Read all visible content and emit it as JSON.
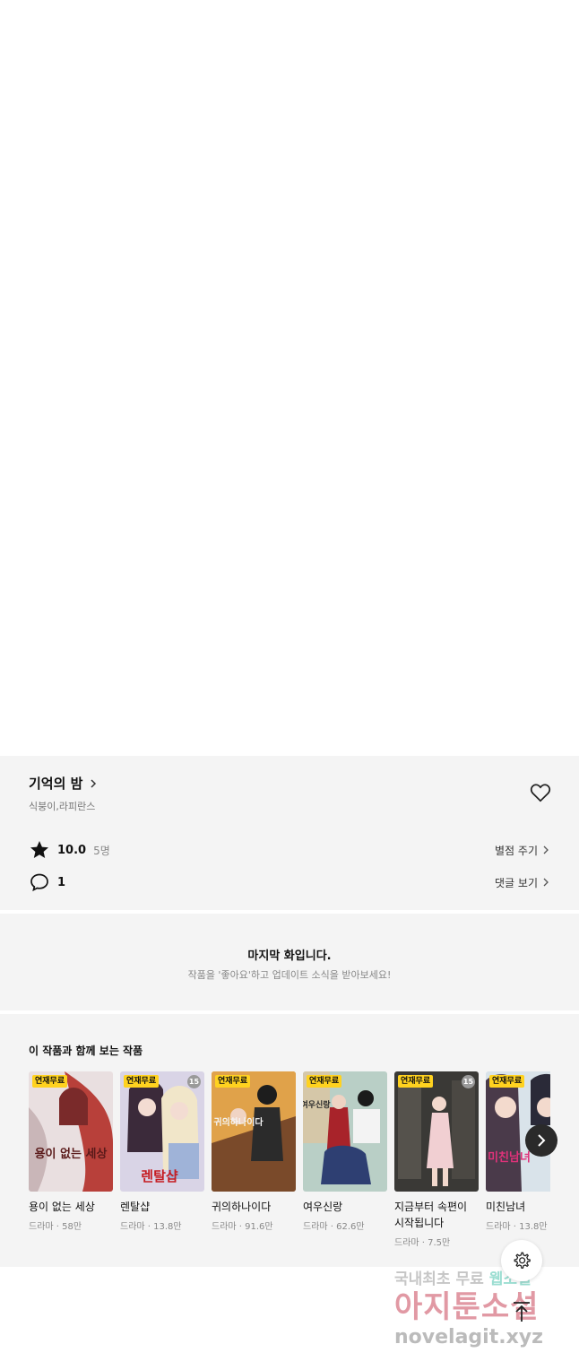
{
  "work": {
    "title": "기억의 밤",
    "authors": "식붕이,라피란스",
    "rating": "10.0",
    "rating_count": "5명",
    "rate_link": "별점 주기",
    "comment_count": "1",
    "comment_link": "댓글 보기"
  },
  "last_episode": {
    "title": "마지막 화입니다.",
    "subtitle": "작품을 '좋아요'하고 업데이트 소식을 받아보세요!"
  },
  "recommendations": {
    "title": "이 작품과 함께 보는 작품",
    "items": [
      {
        "name": "용이 없는 세상",
        "meta": "드라마 · 58만",
        "badge": "연재무료",
        "age": "",
        "cover_text": "용이 없는 세상"
      },
      {
        "name": "렌탈샵",
        "meta": "드라마 · 13.8만",
        "badge": "연재무료",
        "age": "15",
        "cover_text": "렌탈샵"
      },
      {
        "name": "귀의하나이다",
        "meta": "드라마 · 91.6만",
        "badge": "연재무료",
        "age": "",
        "cover_text": "귀의하나이다"
      },
      {
        "name": "여우신랑",
        "meta": "드라마 · 62.6만",
        "badge": "연재무료",
        "age": "",
        "cover_text": "여우신랑"
      },
      {
        "name": "지금부터 속편이 시작됩니다",
        "meta": "드라마 · 7.5만",
        "badge": "연재무료",
        "age": "15",
        "cover_text": ""
      },
      {
        "name": "미친남녀",
        "meta": "드라마 · 13.8만",
        "badge": "연재무료",
        "age": "",
        "cover_text": "미친남녀"
      }
    ]
  },
  "watermark": {
    "line1_a": "국내최초 무료 ",
    "line1_b": "웹소설",
    "line2": "아지툰소설",
    "line3": "novelagit.xyz"
  },
  "colors": {
    "background": "#ffffff",
    "card": "#f4f4f4",
    "badge": "#ffd21f",
    "text": "#111111",
    "muted": "#888888"
  }
}
